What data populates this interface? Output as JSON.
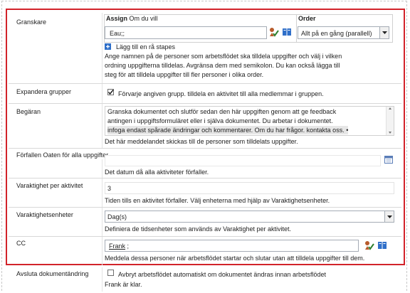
{
  "granskare": {
    "label": "Granskare",
    "assign_header": "Assign",
    "assign_sub": "Om du vill",
    "order_header": "Order",
    "assign_value": "Eau;;",
    "order_value": "Allt på en gång (parallell)",
    "add_stage": "Lägg till en rå stapes",
    "help": [
      "Ange namnen på de personer som arbetsflödet ska tilldela uppgifter och välj i vilken",
      "ordning uppgifterna tilldelas. Avgränsa dem med semikolon. Du kan också lägga till",
      "steg för att tilldela uppgifter till fler personer i olika order."
    ]
  },
  "expandera": {
    "label": "Expandera grupper",
    "checkbox_text": "Förvarje angiven grupp. tilldela en aktivitet till alla medlemmar i gruppen."
  },
  "begaran": {
    "label": "Begäran",
    "lines": [
      "Granska dokumentet och slutför sedan den här uppgiften genom att ge feedback",
      "antingen i uppgiftsformuläret eller i själva dokumentet. Du arbetar i dokumentet.",
      "infoga endast spårade ändringar och kommentarer. Om du har frågor. kontakta oss. •"
    ],
    "help": "Det här meddelandet skickas till de personer som tilldelats uppgifter."
  },
  "forfallen": {
    "label": "Förfallen Oaten för alla uppgifter",
    "help": "Det datum då alla aktiviteter förfaller."
  },
  "varaktighet": {
    "label": "Varaktighet per aktivitet",
    "value": "3",
    "help": "Tiden tills en aktivitet förfaller. Välj enheterna med hjälp av Varaktighetsenheter."
  },
  "enheter": {
    "label": "Varaktighetsenheter",
    "value": "Dag(s)",
    "help": "Definiera de tidsenheter som används av Varaktighet per aktivitet."
  },
  "cc": {
    "label": "CC",
    "value_name": "Frank",
    "value_rest": ";",
    "help": "Meddela dessa personer när arbetsflödet startar och slutar utan att tilldela uppgifter till dem."
  },
  "avsluta": {
    "label": "Avsluta dokumentändring",
    "checkbox_text": "Avbryt arbetsflödet automatiskt om dokumentet ändras innan arbetsflödet",
    "help": "Frank är klar."
  },
  "colors": {
    "red_border": "#d2232a",
    "link_blue": "#0f52b5",
    "icon_blue": "#2f6fc9"
  },
  "icons": [
    "check-names-icon",
    "address-book-icon",
    "add-stage-icon",
    "calendar-icon",
    "dropdown-arrow-icon"
  ]
}
